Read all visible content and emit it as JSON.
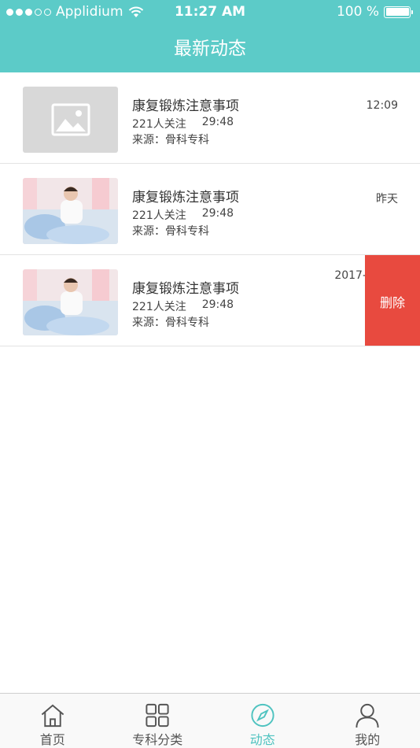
{
  "status_bar": {
    "carrier": "Applidium",
    "time": "11:27 AM",
    "battery": "100 %"
  },
  "header": {
    "title": "最新动态"
  },
  "items": [
    {
      "title": "康复锻炼注意事项",
      "followers": "221人关注",
      "duration": "29:48",
      "source": "来源：骨科专科",
      "time": "12:09",
      "thumb": "placeholder-image-icon"
    },
    {
      "title": "康复锻炼注意事项",
      "followers": "221人关注",
      "duration": "29:48",
      "source": "来源：骨科专科",
      "time": "昨天",
      "thumb": "nurse-photo"
    },
    {
      "title": "康复锻炼注意事项",
      "followers": "221人关注",
      "duration": "29:48",
      "source": "来源：骨科专科",
      "time": "2017-",
      "thumb": "nurse-photo",
      "delete_label": "删除"
    }
  ],
  "tabs": [
    {
      "label": "首页",
      "icon": "home-icon",
      "active": false
    },
    {
      "label": "专科分类",
      "icon": "grid-icon",
      "active": false
    },
    {
      "label": "动态",
      "icon": "compass-icon",
      "active": true
    },
    {
      "label": "我的",
      "icon": "user-icon",
      "active": false
    }
  ],
  "colors": {
    "accent": "#5ccbc8",
    "delete": "#e84a3f",
    "tab_active": "#4fc3c0"
  }
}
